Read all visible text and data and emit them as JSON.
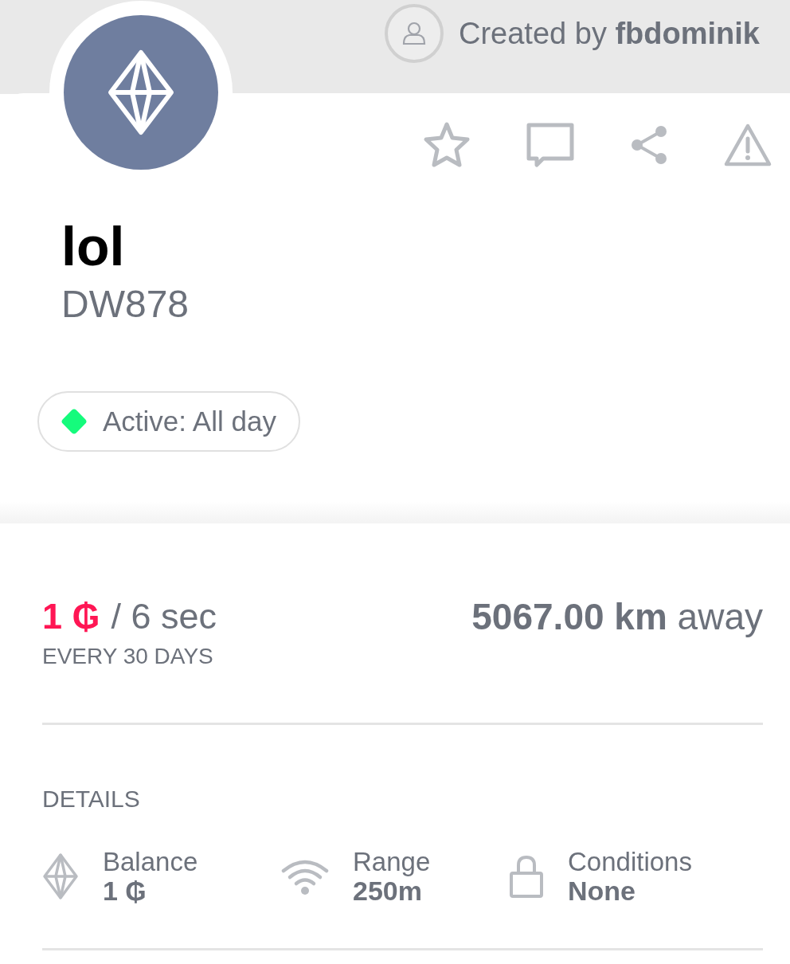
{
  "creator": {
    "text": "Created by **fbdominik**"
  },
  "actions": [
    {
      "kind": "star"
    },
    {
      "kind": "comment"
    },
    {
      "kind": "share"
    },
    {
      "kind": "warning"
    }
  ],
  "title": "lol",
  "code": "DW878",
  "status": {
    "label": "Active: All day",
    "color": "#15fb7c"
  },
  "rate": {
    "amount": "1 ₲",
    "period": "/ 6 sec",
    "frequency": "EVERY 30 DAYS"
  },
  "distance": "**5067.00 km** away",
  "details": {
    "heading": "DETAILS",
    "items": [
      {
        "kind": "balance",
        "label": "Balance",
        "value": "1 ₲"
      },
      {
        "kind": "range",
        "label": "Range",
        "value": "250m"
      },
      {
        "kind": "conditions",
        "label": "Conditions",
        "value": "None"
      }
    ]
  }
}
